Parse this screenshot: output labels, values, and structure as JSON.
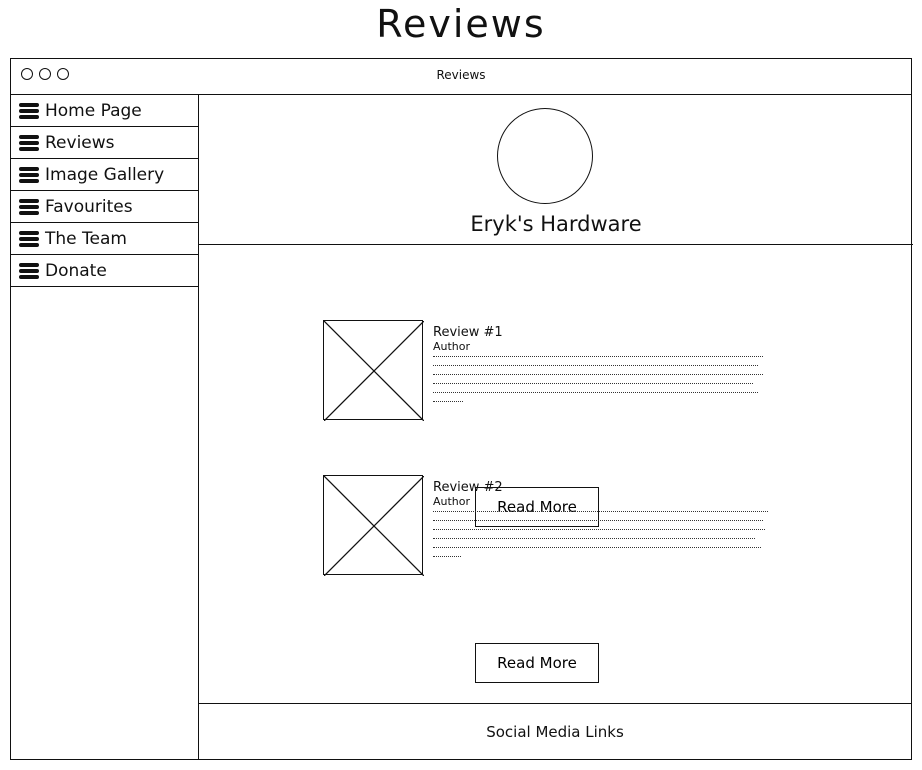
{
  "page": {
    "heading": "Reviews"
  },
  "window": {
    "title": "Reviews"
  },
  "sidebar": {
    "items": [
      {
        "label": "Home Page"
      },
      {
        "label": "Reviews"
      },
      {
        "label": "Image Gallery"
      },
      {
        "label": "Favourites"
      },
      {
        "label": "The Team"
      },
      {
        "label": "Donate"
      }
    ]
  },
  "header": {
    "brand": "Eryk's Hardware"
  },
  "reviews": [
    {
      "title": "Review #1",
      "author": "Author",
      "button": "Read More"
    },
    {
      "title": "Review #2",
      "author": "Author",
      "button": "Read More"
    }
  ],
  "footer": {
    "label": "Social Media Links"
  },
  "icons": {
    "window_controls": "three-circle-icons",
    "nav": "hamburger-icon",
    "logo": "circle-logo",
    "image_placeholder": "x-box-image-icon"
  }
}
